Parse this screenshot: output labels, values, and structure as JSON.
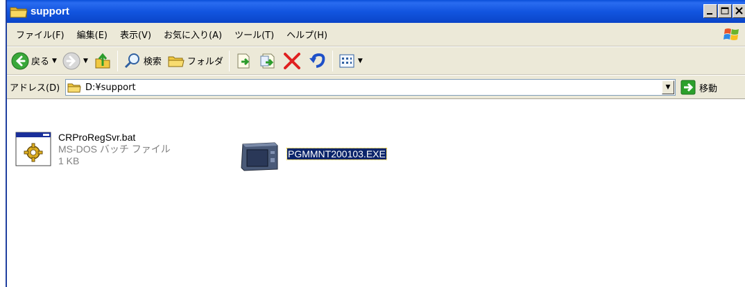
{
  "window": {
    "title": "support"
  },
  "menu": {
    "items": [
      "ファイル(F)",
      "編集(E)",
      "表示(V)",
      "お気に入り(A)",
      "ツール(T)",
      "ヘルプ(H)"
    ]
  },
  "toolbar": {
    "back_label": "戻る",
    "search_label": "検索",
    "folders_label": "フォルダ"
  },
  "address": {
    "label": "アドレス(D)",
    "value": "D:¥support",
    "go_label": "移動"
  },
  "files": [
    {
      "name": "CRProRegSvr.bat",
      "type": "MS-DOS バッチ ファイル",
      "size": "1 KB",
      "icon": "batch-file-icon",
      "selected": false
    },
    {
      "name": "PGMMNT200103.EXE",
      "icon": "application-exe-icon",
      "selected": true
    }
  ],
  "colors": {
    "titlebar": "#0a4fd8",
    "chrome": "#ece9d8",
    "selection": "#0a246a"
  }
}
